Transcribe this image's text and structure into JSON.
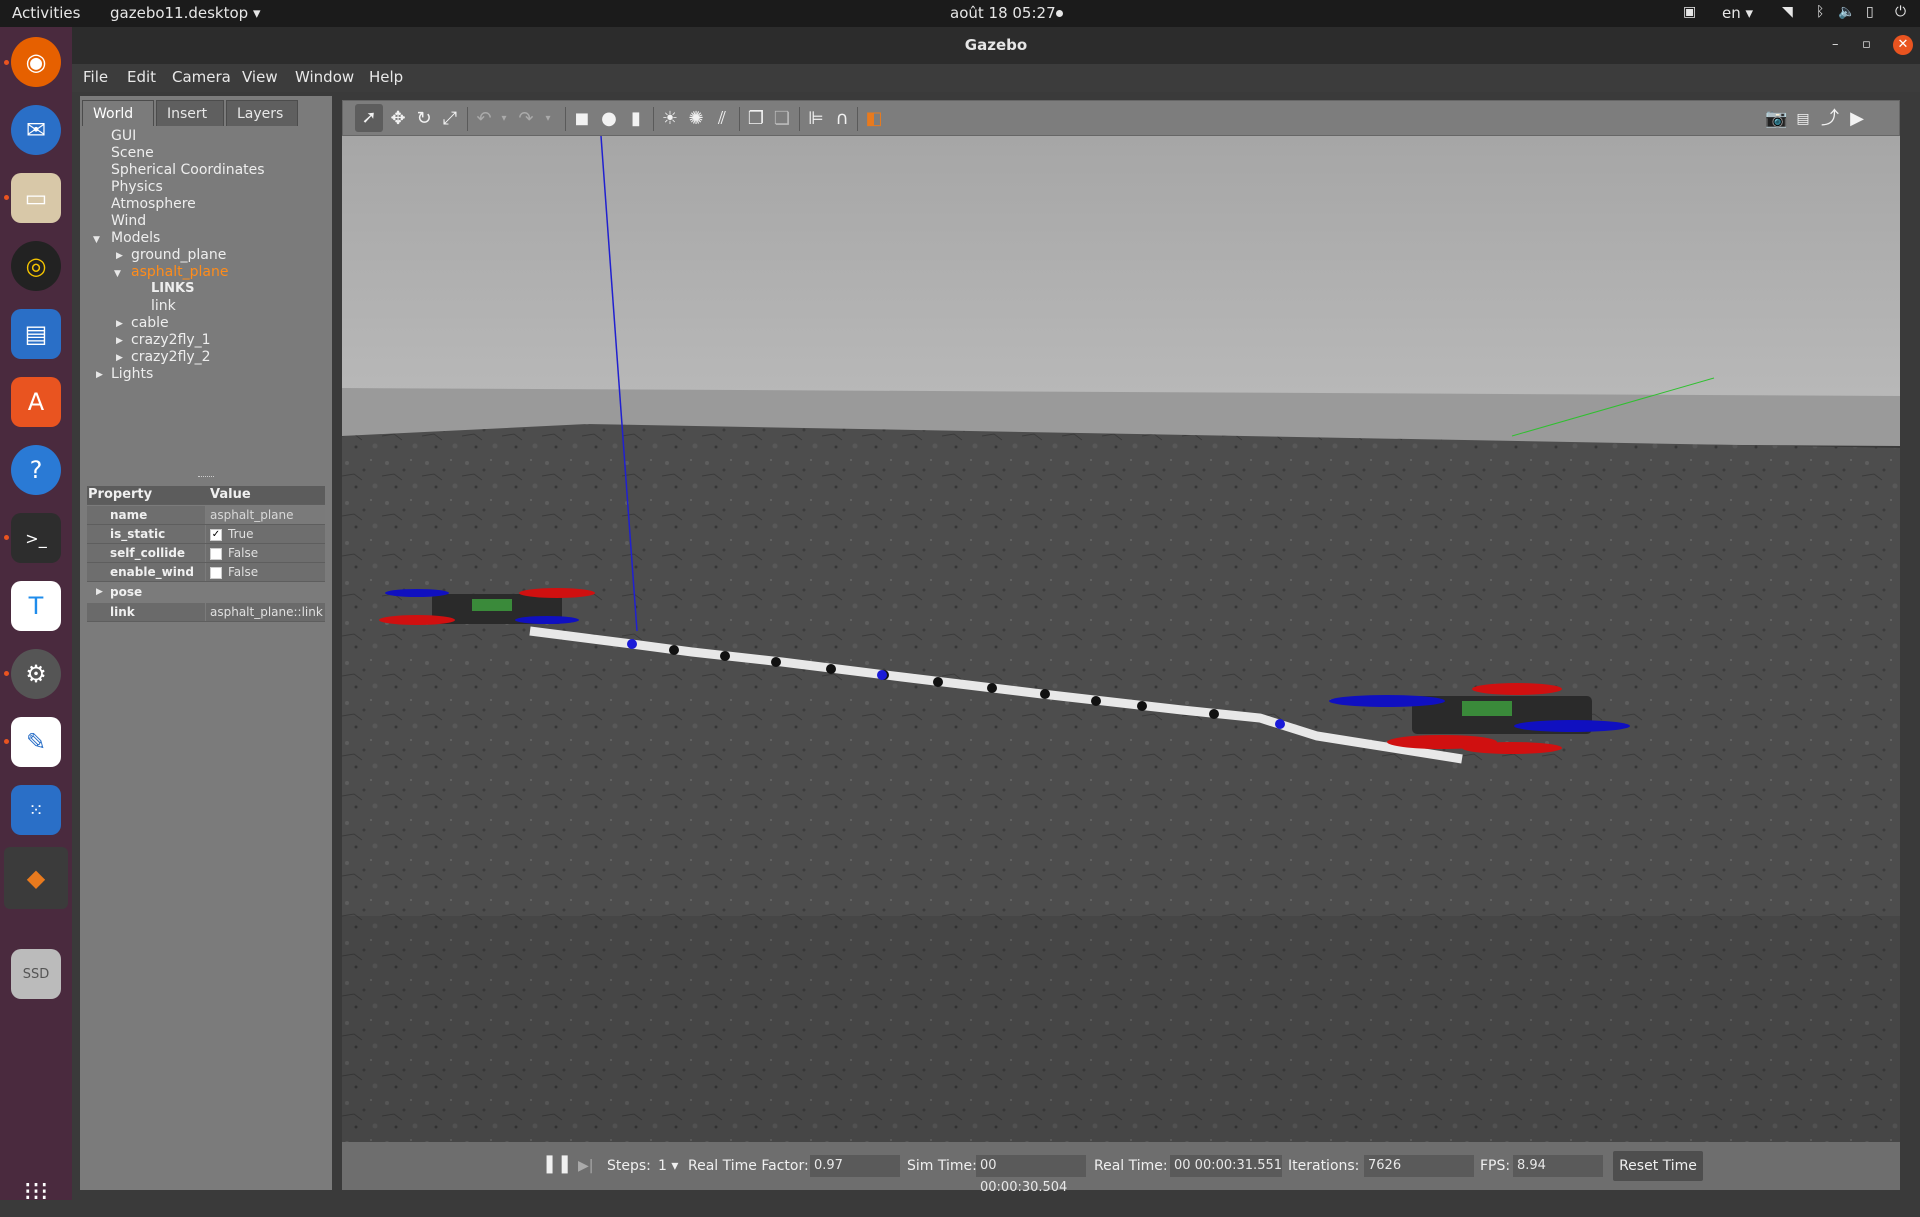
{
  "topbar": {
    "activities": "Activities",
    "app_menu": "gazebo11.desktop ▾",
    "clock": "août 18  05:27",
    "lang": "en ▾"
  },
  "window": {
    "title": "Gazebo"
  },
  "menu": [
    "File",
    "Edit",
    "Camera",
    "View",
    "Window",
    "Help"
  ],
  "tabs": [
    "World",
    "Insert",
    "Layers"
  ],
  "tree": {
    "gui": "GUI",
    "scene": "Scene",
    "spherical": "Spherical Coordinates",
    "physics": "Physics",
    "atmosphere": "Atmosphere",
    "wind": "Wind",
    "models": "Models",
    "ground_plane": "ground_plane",
    "asphalt_plane": "asphalt_plane",
    "links_header": "LINKS",
    "link": "link",
    "cable": "cable",
    "crazy1": "crazy2fly_1",
    "crazy2": "crazy2fly_2",
    "lights": "Lights"
  },
  "properties": {
    "header_property": "Property",
    "header_value": "Value",
    "rows": [
      {
        "key": "name",
        "value": "asphalt_plane"
      },
      {
        "key": "is_static",
        "value": "True"
      },
      {
        "key": "self_collide",
        "value": "False"
      },
      {
        "key": "enable_wind",
        "value": "False"
      },
      {
        "key": "pose",
        "value": ""
      },
      {
        "key": "link",
        "value": "asphalt_plane::link"
      }
    ]
  },
  "bottombar": {
    "steps_label": "Steps:",
    "steps_value": "1 ▾",
    "rtf_label": "Real Time Factor:",
    "rtf_value": "0.97",
    "simtime_label": "Sim Time:",
    "simtime_value": "00 00:00:30.504",
    "realtime_label": "Real Time:",
    "realtime_value": "00 00:00:31.551",
    "iterations_label": "Iterations:",
    "iterations_value": "7626",
    "fps_label": "FPS:",
    "fps_value": "8.94",
    "reset_label": "Reset Time"
  },
  "dock": {
    "ssd_label": "SSD"
  },
  "colors": {
    "selected_text": "#ff8c1a",
    "accent": "#e95420"
  }
}
